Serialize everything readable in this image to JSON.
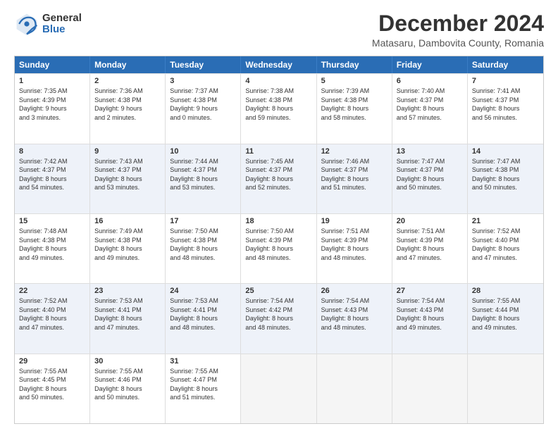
{
  "header": {
    "logo_general": "General",
    "logo_blue": "Blue",
    "main_title": "December 2024",
    "subtitle": "Matasaru, Dambovita County, Romania"
  },
  "calendar": {
    "days_of_week": [
      "Sunday",
      "Monday",
      "Tuesday",
      "Wednesday",
      "Thursday",
      "Friday",
      "Saturday"
    ],
    "weeks": [
      [
        {
          "day": "",
          "info": ""
        },
        {
          "day": "2",
          "info": "Sunrise: 7:36 AM\nSunset: 4:38 PM\nDaylight: 9 hours\nand 2 minutes."
        },
        {
          "day": "3",
          "info": "Sunrise: 7:37 AM\nSunset: 4:38 PM\nDaylight: 9 hours\nand 0 minutes."
        },
        {
          "day": "4",
          "info": "Sunrise: 7:38 AM\nSunset: 4:38 PM\nDaylight: 8 hours\nand 59 minutes."
        },
        {
          "day": "5",
          "info": "Sunrise: 7:39 AM\nSunset: 4:38 PM\nDaylight: 8 hours\nand 58 minutes."
        },
        {
          "day": "6",
          "info": "Sunrise: 7:40 AM\nSunset: 4:37 PM\nDaylight: 8 hours\nand 57 minutes."
        },
        {
          "day": "7",
          "info": "Sunrise: 7:41 AM\nSunset: 4:37 PM\nDaylight: 8 hours\nand 56 minutes."
        }
      ],
      [
        {
          "day": "1",
          "info": "Sunrise: 7:35 AM\nSunset: 4:39 PM\nDaylight: 9 hours\nand 3 minutes."
        },
        {
          "day": "8",
          "info": ""
        },
        {
          "day": "",
          "info": ""
        },
        {
          "day": "",
          "info": ""
        },
        {
          "day": "",
          "info": ""
        },
        {
          "day": "",
          "info": ""
        },
        {
          "day": "",
          "info": ""
        }
      ],
      [
        {
          "day": "8",
          "info": "Sunrise: 7:42 AM\nSunset: 4:37 PM\nDaylight: 8 hours\nand 54 minutes."
        },
        {
          "day": "9",
          "info": "Sunrise: 7:43 AM\nSunset: 4:37 PM\nDaylight: 8 hours\nand 53 minutes."
        },
        {
          "day": "10",
          "info": "Sunrise: 7:44 AM\nSunset: 4:37 PM\nDaylight: 8 hours\nand 53 minutes."
        },
        {
          "day": "11",
          "info": "Sunrise: 7:45 AM\nSunset: 4:37 PM\nDaylight: 8 hours\nand 52 minutes."
        },
        {
          "day": "12",
          "info": "Sunrise: 7:46 AM\nSunset: 4:37 PM\nDaylight: 8 hours\nand 51 minutes."
        },
        {
          "day": "13",
          "info": "Sunrise: 7:47 AM\nSunset: 4:37 PM\nDaylight: 8 hours\nand 50 minutes."
        },
        {
          "day": "14",
          "info": "Sunrise: 7:47 AM\nSunset: 4:38 PM\nDaylight: 8 hours\nand 50 minutes."
        }
      ],
      [
        {
          "day": "15",
          "info": "Sunrise: 7:48 AM\nSunset: 4:38 PM\nDaylight: 8 hours\nand 49 minutes."
        },
        {
          "day": "16",
          "info": "Sunrise: 7:49 AM\nSunset: 4:38 PM\nDaylight: 8 hours\nand 49 minutes."
        },
        {
          "day": "17",
          "info": "Sunrise: 7:50 AM\nSunset: 4:38 PM\nDaylight: 8 hours\nand 48 minutes."
        },
        {
          "day": "18",
          "info": "Sunrise: 7:50 AM\nSunset: 4:39 PM\nDaylight: 8 hours\nand 48 minutes."
        },
        {
          "day": "19",
          "info": "Sunrise: 7:51 AM\nSunset: 4:39 PM\nDaylight: 8 hours\nand 48 minutes."
        },
        {
          "day": "20",
          "info": "Sunrise: 7:51 AM\nSunset: 4:39 PM\nDaylight: 8 hours\nand 47 minutes."
        },
        {
          "day": "21",
          "info": "Sunrise: 7:52 AM\nSunset: 4:40 PM\nDaylight: 8 hours\nand 47 minutes."
        }
      ],
      [
        {
          "day": "22",
          "info": "Sunrise: 7:52 AM\nSunset: 4:40 PM\nDaylight: 8 hours\nand 47 minutes."
        },
        {
          "day": "23",
          "info": "Sunrise: 7:53 AM\nSunset: 4:41 PM\nDaylight: 8 hours\nand 47 minutes."
        },
        {
          "day": "24",
          "info": "Sunrise: 7:53 AM\nSunset: 4:41 PM\nDaylight: 8 hours\nand 48 minutes."
        },
        {
          "day": "25",
          "info": "Sunrise: 7:54 AM\nSunset: 4:42 PM\nDaylight: 8 hours\nand 48 minutes."
        },
        {
          "day": "26",
          "info": "Sunrise: 7:54 AM\nSunset: 4:43 PM\nDaylight: 8 hours\nand 48 minutes."
        },
        {
          "day": "27",
          "info": "Sunrise: 7:54 AM\nSunset: 4:43 PM\nDaylight: 8 hours\nand 49 minutes."
        },
        {
          "day": "28",
          "info": "Sunrise: 7:55 AM\nSunset: 4:44 PM\nDaylight: 8 hours\nand 49 minutes."
        }
      ],
      [
        {
          "day": "29",
          "info": "Sunrise: 7:55 AM\nSunset: 4:45 PM\nDaylight: 8 hours\nand 50 minutes."
        },
        {
          "day": "30",
          "info": "Sunrise: 7:55 AM\nSunset: 4:46 PM\nDaylight: 8 hours\nand 50 minutes."
        },
        {
          "day": "31",
          "info": "Sunrise: 7:55 AM\nSunset: 4:47 PM\nDaylight: 8 hours\nand 51 minutes."
        },
        {
          "day": "",
          "info": ""
        },
        {
          "day": "",
          "info": ""
        },
        {
          "day": "",
          "info": ""
        },
        {
          "day": "",
          "info": ""
        }
      ]
    ]
  }
}
